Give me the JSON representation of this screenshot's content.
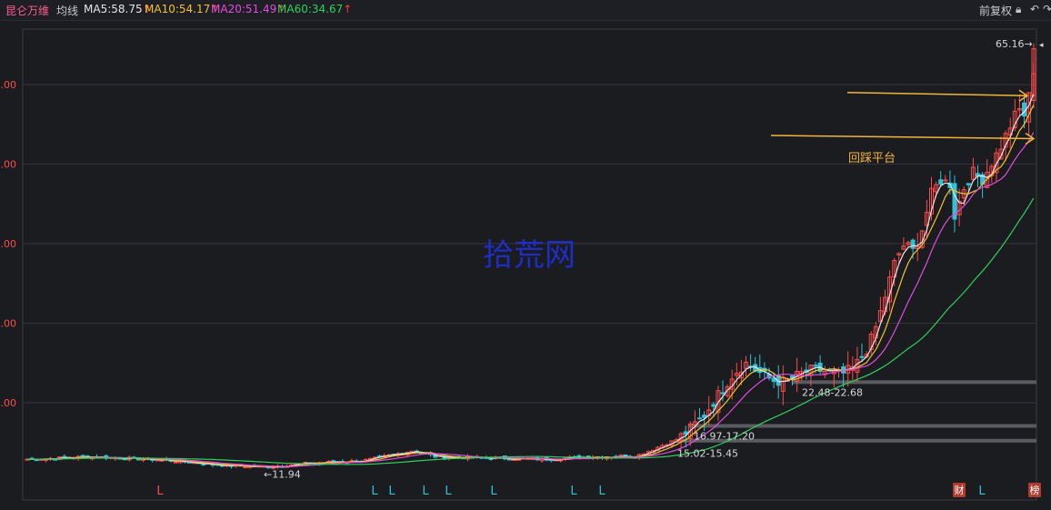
{
  "header": {
    "stock_name": "昆仑万维",
    "indicator_label": "均线",
    "ma5": {
      "label": "MA5:58.75",
      "arrow": "↑"
    },
    "ma10": {
      "label": "MA10:54.17",
      "arrow": "↑"
    },
    "ma20": {
      "label": "MA20:51.49",
      "arrow": "↑"
    },
    "ma60": {
      "label": "MA60:34.67",
      "arrow": "↑"
    },
    "adjust_label": "前复权",
    "icons": [
      "lock-icon",
      "undo-icon",
      "redo-icon"
    ]
  },
  "colors": {
    "background": "#1b1c20",
    "up": "#ff4a4a",
    "down": "#2bc4d8",
    "ma5": "#e6e6e6",
    "ma10": "#f1c232",
    "ma20": "#e14be0",
    "ma60": "#2fd05a",
    "annotation": "#f1b43a",
    "watermark": "#1f2fd6",
    "y_label": "#ff4a4a"
  },
  "chart_data": {
    "type": "candlestick",
    "y_tick_labels": [
      "0.00",
      "0.00",
      "0.00",
      "0.00",
      "0.00"
    ],
    "y_ticks": [
      60,
      50,
      40,
      30,
      20
    ],
    "ylim": [
      8,
      67
    ],
    "grid": true,
    "price_labels": [
      {
        "text": "65.16→",
        "value": 65.16
      },
      {
        "text": "←11.94",
        "value": 11.94
      },
      {
        "text": "15.02-15.45",
        "value": 15.02
      },
      {
        "text": "16.97-17.20",
        "value": 16.97
      },
      {
        "text": "22.48-22.68",
        "value": 22.48
      }
    ],
    "support_levels": [
      {
        "low": 15.02,
        "high": 15.45
      },
      {
        "low": 16.97,
        "high": 17.2
      },
      {
        "low": 22.48,
        "high": 22.68
      }
    ],
    "annotation_text": "回踩平台",
    "annotation_lines": [
      {
        "y_start": 59.0,
        "y_end": 58.6
      },
      {
        "y_start": 53.6,
        "y_end": 53.2
      }
    ],
    "watermark": "拾荒网",
    "markers": [
      {
        "text": "L",
        "color": "red"
      },
      {
        "text": "L",
        "color": "cyan"
      },
      {
        "text": "L",
        "color": "cyan"
      },
      {
        "text": "L",
        "color": "cyan"
      },
      {
        "text": "L",
        "color": "cyan"
      },
      {
        "text": "L",
        "color": "cyan"
      },
      {
        "text": "L",
        "color": "cyan"
      },
      {
        "text": "L",
        "color": "cyan"
      },
      {
        "text": "财",
        "color": "badge"
      },
      {
        "text": "L",
        "color": "cyan"
      },
      {
        "text": "榜",
        "color": "badge"
      }
    ],
    "ma_last": {
      "ma5": 58.75,
      "ma10": 54.17,
      "ma20": 51.49,
      "ma60": 34.67
    }
  }
}
